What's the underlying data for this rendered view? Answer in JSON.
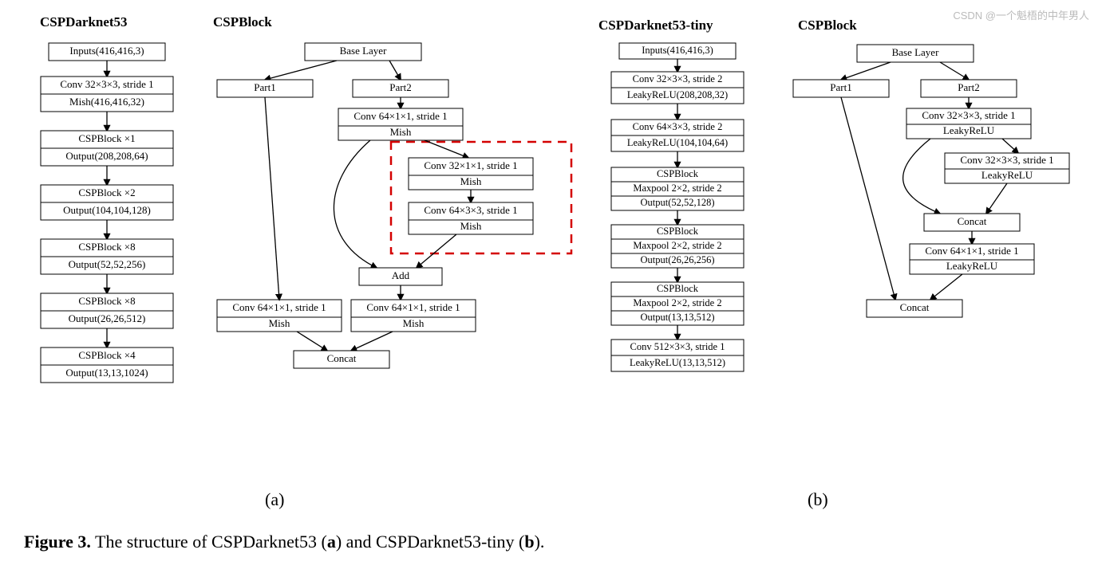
{
  "headings": {
    "h1": "CSPDarknet53",
    "h2": "CSPBlock",
    "h3": "CSPDarknet53-tiny",
    "h4": "CSPBlock"
  },
  "col1": {
    "n0": "Inputs(416,416,3)",
    "n1a": "Conv 32×3×3, stride 1",
    "n1b": "Mish(416,416,32)",
    "n2a": "CSPBlock ×1",
    "n2b": "Output(208,208,64)",
    "n3a": "CSPBlock ×2",
    "n3b": "Output(104,104,128)",
    "n4a": "CSPBlock ×8",
    "n4b": "Output(52,52,256)",
    "n5a": "CSPBlock ×8",
    "n5b": "Output(26,26,512)",
    "n6a": "CSPBlock ×4",
    "n6b": "Output(13,13,1024)"
  },
  "block_a": {
    "base": "Base Layer",
    "p1": "Part1",
    "p2": "Part2",
    "conv_a": "Conv 64×1×1, stride 1",
    "mish": "Mish",
    "res1a": "Conv 32×1×1, stride 1",
    "res1b": "Mish",
    "res2a": "Conv 64×3×3, stride 1",
    "res2b": "Mish",
    "add": "Add",
    "out1a": "Conv 64×1×1, stride 1",
    "out1b": "Mish",
    "out2a": "Conv 64×1×1, stride 1",
    "out2b": "Mish",
    "concat": "Concat"
  },
  "col3": {
    "n0": "Inputs(416,416,3)",
    "n1a": "Conv 32×3×3, stride 2",
    "n1b": "LeakyReLU(208,208,32)",
    "n2a": "Conv 64×3×3, stride 2",
    "n2b": "LeakyReLU(104,104,64)",
    "n3a": "CSPBlock",
    "n3b": "Maxpool 2×2, stride 2",
    "n3c": "Output(52,52,128)",
    "n4a": "CSPBlock",
    "n4b": "Maxpool 2×2, stride 2",
    "n4c": "Output(26,26,256)",
    "n5a": "CSPBlock",
    "n5b": "Maxpool 2×2, stride 2",
    "n5c": "Output(13,13,512)",
    "n6a": "Conv 512×3×3, stride 1",
    "n6b": "LeakyReLU(13,13,512)"
  },
  "block_b": {
    "base": "Base Layer",
    "p1": "Part1",
    "p2": "Part2",
    "c1a": "Conv 32×3×3, stride 1",
    "c1b": "LeakyReLU",
    "c2a": "Conv 32×3×3, stride 1",
    "c2b": "LeakyReLU",
    "concat1": "Concat",
    "c3a": "Conv 64×1×1, stride 1",
    "c3b": "LeakyReLU",
    "concat2": "Concat"
  },
  "sub_a": "(a)",
  "sub_b": "(b)",
  "caption": {
    "fig": "Figure 3.",
    "text": " The structure of CSPDarknet53 (",
    "a": "a",
    "mid": ") and CSPDarknet53-tiny (",
    "b": "b",
    "end": ")."
  },
  "watermark": "CSDN @一个魁梧的中年男人"
}
